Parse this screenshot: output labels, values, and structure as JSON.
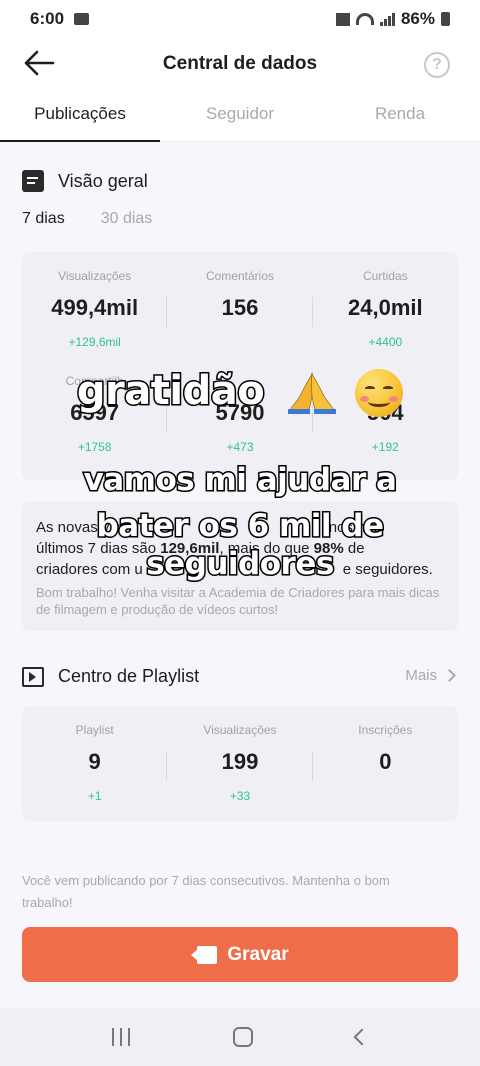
{
  "status_bar": {
    "time": "6:00",
    "battery": "86%"
  },
  "header": {
    "title": "Central de dados",
    "help_symbol": "?"
  },
  "tabs": [
    {
      "label": "Publicações",
      "active": true
    },
    {
      "label": "Seguidor",
      "active": false
    },
    {
      "label": "Renda",
      "active": false
    }
  ],
  "overview": {
    "title": "Visão geral",
    "periods": [
      "7 dias",
      "30 dias"
    ],
    "selected_period": "7 dias",
    "stats": [
      {
        "label": "Visualizações",
        "value": "499,4mil",
        "delta": "+129,6mil"
      },
      {
        "label": "Comentários",
        "value": "156",
        "delta": ""
      },
      {
        "label": "Curtidas",
        "value": "24,0mil",
        "delta": "+4400"
      },
      {
        "label": "Compartilh",
        "value": "6597",
        "delta": "+1758"
      },
      {
        "label": "",
        "value": "5790",
        "delta": "+473"
      },
      {
        "label": "P",
        "value": "504",
        "delta": "+192"
      }
    ]
  },
  "info": {
    "line1_a": "As novas vis",
    "line1_b": "t",
    "line1_c": "nos nos",
    "line2_a": "últimos 7 dias são ",
    "line2_b": "129,6mil",
    "line2_c": ", mais do que ",
    "line2_d": "98%",
    "line2_e": " de",
    "line3_a": "criadores com u",
    "line3_b": "e seguidores.",
    "sub": "Bom trabalho! Venha visitar a Academia de Criadores para mais dicas de filmagem e produção de vídeos curtos!"
  },
  "playlist": {
    "title": "Centro de Playlist",
    "more": "Mais",
    "stats": [
      {
        "label": "Playlist",
        "value": "9",
        "delta": "+1"
      },
      {
        "label": "Visualizações",
        "value": "199",
        "delta": "+33"
      },
      {
        "label": "Inscrições",
        "value": "0",
        "delta": ""
      }
    ]
  },
  "footer_note": "Você vem publicando por 7 dias consecutivos. Mantenha o bom trabalho!",
  "record_button": "Gravar",
  "overlay": {
    "line1": "gratidão",
    "line2": "vamos mi ajudar a",
    "line3": "bater os 6 mil de",
    "line4": "seguidores"
  },
  "colors": {
    "accent": "#ef6e4a",
    "positive": "#2ec48b"
  }
}
